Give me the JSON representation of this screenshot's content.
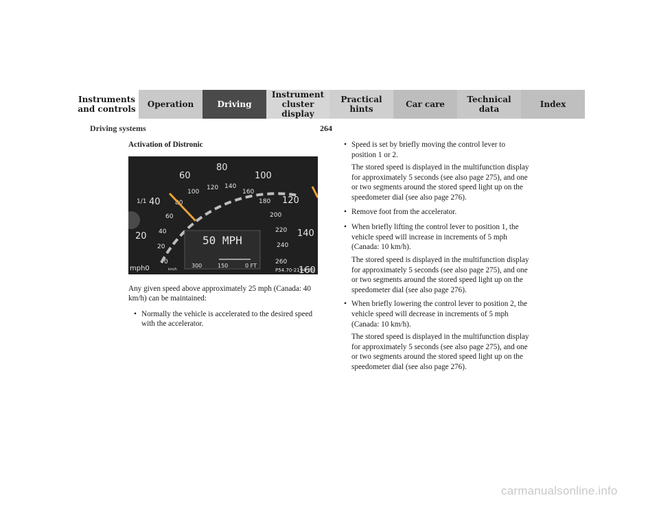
{
  "nav": {
    "tabs": [
      {
        "label": "Instruments\nand controls"
      },
      {
        "label": "Operation"
      },
      {
        "label": "Driving",
        "active": true
      },
      {
        "label": "Instrument\ncluster display"
      },
      {
        "label": "Practical hints"
      },
      {
        "label": "Car care"
      },
      {
        "label": "Technical\ndata"
      },
      {
        "label": "Index"
      }
    ]
  },
  "header": {
    "section": "Driving systems",
    "page": "264"
  },
  "left": {
    "heading": "Activation of Distronic",
    "intro": "Any given speed above approximately 25 mph (Canada: 40 km/h) can be maintained:",
    "bullet1": "Normally the vehicle is accelerated to the desired speed with the accelerator."
  },
  "figure": {
    "display_text": "50 MPH",
    "distance_labels": [
      "300",
      "150",
      "0 FT"
    ],
    "code": "P54.70-2194-26",
    "outer_labels": [
      "mph0",
      "20",
      "40",
      "60",
      "80",
      "100",
      "120",
      "140",
      "160"
    ],
    "inner_labels": [
      "0",
      "20",
      "40",
      "60",
      "80",
      "100",
      "120",
      "140",
      "160",
      "180",
      "200",
      "220",
      "240",
      "260"
    ],
    "unit_kmh": "km/h",
    "side_label": "1/1",
    "colors": {
      "needle": "#e8a33a",
      "dial_bg": "#202020"
    }
  },
  "right": {
    "b1": "Speed is set by briefly moving the control lever to position 1 or 2.",
    "b1_sub": "The stored speed is displayed in the multifunction display for approximately 5 seconds (see also page 275), and one or two segments around the stored speed light up on the speedometer dial (see also page 276).",
    "b2": "Remove foot from the accelerator.",
    "b3": "When briefly lifting the control lever to position 1, the vehicle speed will increase in increments of 5 mph (Canada: 10 km/h).",
    "b3_sub": "The stored speed is displayed in the multifunction display for approximately 5 seconds (see also page 275), and one or two segments around the stored speed light up on the speedometer dial (see also page 276).",
    "b4": "When briefly lowering the control lever to position 2, the vehicle speed will decrease in increments of 5 mph (Canada: 10 km/h).",
    "b4_sub": "The stored speed is displayed in the multifunction display for approximately 5 seconds (see also page 275), and one or two segments around the stored speed light up on the speedometer dial (see also page 276)."
  },
  "footer": {
    "watermark": "carmanualsonline.info"
  }
}
